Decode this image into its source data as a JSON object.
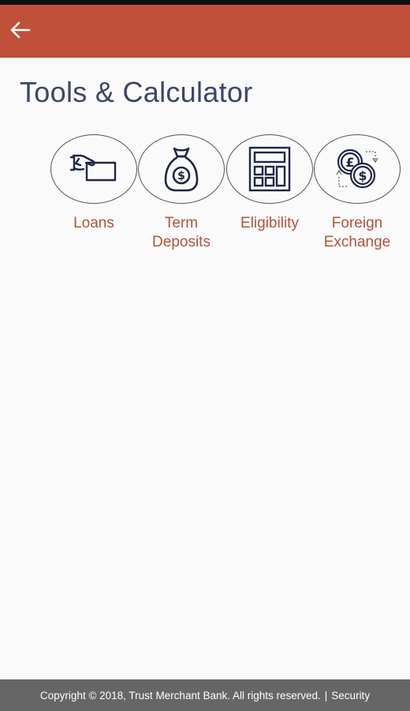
{
  "header": {
    "background_color": "#c0503a",
    "back_icon": "arrow-left-icon"
  },
  "page": {
    "title": "Tools & Calculator"
  },
  "tools": [
    {
      "label": "Loans",
      "icon": "hand-money-icon"
    },
    {
      "label": "Term\nDeposits",
      "icon": "money-bag-icon"
    },
    {
      "label": "Eligibility",
      "icon": "calculator-icon"
    },
    {
      "label": "Foreign\nExchange",
      "icon": "currency-exchange-icon"
    }
  ],
  "footer": {
    "copyright": "Copyright © 2018, Trust Merchant Bank. All rights reserved.",
    "separator": "|",
    "security_link": "Security"
  },
  "colors": {
    "accent": "#c0503a",
    "label": "#b0533c",
    "title": "#3e4566",
    "icon": "#1f2547",
    "footer_bg": "#666666"
  }
}
